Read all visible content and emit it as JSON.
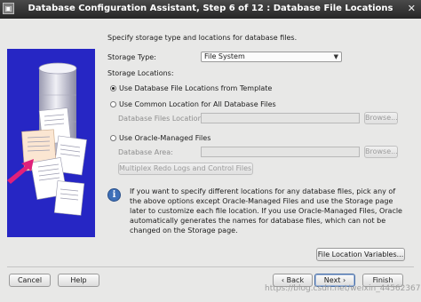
{
  "window": {
    "title": "Database Configuration Assistant, Step 6 of 12 : Database File Locations",
    "close_glyph": "✕",
    "icon_glyph": "▣"
  },
  "intro": "Specify storage type and locations for database files.",
  "storage_type": {
    "label": "Storage Type:",
    "value": "File System"
  },
  "storage_locations": {
    "heading": "Storage Locations:",
    "option_template": "Use Database File Locations from Template",
    "option_common": "Use Common Location for All Database Files",
    "common_field_label": "Database Files Location:",
    "common_field_value": "",
    "common_browse": "Browse...",
    "option_omf": "Use Oracle-Managed Files",
    "omf_field_label": "Database Area:",
    "omf_field_value": "",
    "omf_browse": "Browse...",
    "multiplex_button": "Multiplex Redo Logs and Control Files..."
  },
  "info": {
    "icon": "i",
    "text": "If you want to specify different locations for any database files, pick any of the above options except Oracle-Managed Files and use the Storage page later to customize each file location. If you use Oracle-Managed Files, Oracle automatically generates the names for database files, which can not be changed on the Storage page."
  },
  "file_location_variables": "File Location Variables...",
  "footer": {
    "cancel": "Cancel",
    "help": "Help",
    "back": "Back",
    "next": "Next",
    "finish": "Finish"
  },
  "watermark": "https://blog.csdn.net/weixin_44562367",
  "colors": {
    "sidebar": "#2626c4",
    "pink_arrow": "#e0207a",
    "info_blue": "#3d6fb8"
  }
}
